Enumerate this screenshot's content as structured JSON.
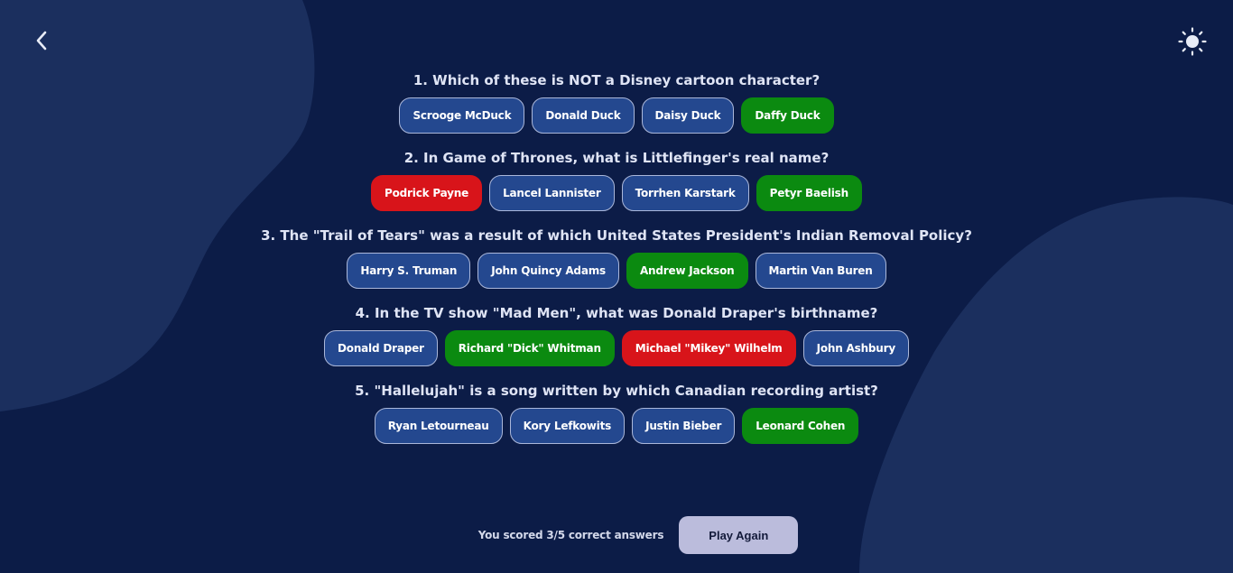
{
  "colors": {
    "background": "#0c1c47",
    "blob": "#1b2f5e",
    "answer_default": "#24488f",
    "answer_correct": "#0b8a10",
    "answer_wrong": "#d8141a",
    "play_button": "#bbbcdc"
  },
  "header": {
    "back_icon": "chevron-left-icon",
    "theme_icon": "sun-icon"
  },
  "questions": [
    {
      "text": "1. Which of these is NOT a Disney cartoon character?",
      "answers": [
        {
          "label": "Scrooge McDuck",
          "state": "default"
        },
        {
          "label": "Donald Duck",
          "state": "default"
        },
        {
          "label": "Daisy Duck",
          "state": "default"
        },
        {
          "label": "Daffy Duck",
          "state": "correct"
        }
      ]
    },
    {
      "text": "2. In Game of Thrones, what is Littlefinger's real name?",
      "answers": [
        {
          "label": "Podrick Payne",
          "state": "wrong"
        },
        {
          "label": "Lancel Lannister",
          "state": "default"
        },
        {
          "label": "Torrhen Karstark",
          "state": "default"
        },
        {
          "label": "Petyr Baelish",
          "state": "correct"
        }
      ]
    },
    {
      "text": "3. The \"Trail of Tears\" was a result of which United States President's Indian Removal Policy?",
      "answers": [
        {
          "label": "Harry S. Truman",
          "state": "default"
        },
        {
          "label": "John Quincy Adams",
          "state": "default"
        },
        {
          "label": "Andrew Jackson",
          "state": "correct"
        },
        {
          "label": "Martin Van Buren",
          "state": "default"
        }
      ]
    },
    {
      "text": "4. In the TV show \"Mad Men\", what was Donald Draper's birthname?",
      "answers": [
        {
          "label": "Donald Draper",
          "state": "default"
        },
        {
          "label": "Richard \"Dick\" Whitman",
          "state": "correct"
        },
        {
          "label": "Michael \"Mikey\" Wilhelm",
          "state": "wrong"
        },
        {
          "label": "John Ashbury",
          "state": "default"
        }
      ]
    },
    {
      "text": "5. \"Hallelujah\" is a song written by which Canadian recording artist?",
      "answers": [
        {
          "label": "Ryan Letourneau",
          "state": "default"
        },
        {
          "label": "Kory Lefkowits",
          "state": "default"
        },
        {
          "label": "Justin Bieber",
          "state": "default"
        },
        {
          "label": "Leonard Cohen",
          "state": "correct"
        }
      ]
    }
  ],
  "footer": {
    "score_text": "You scored 3/5 correct answers",
    "play_again_label": "Play Again"
  }
}
